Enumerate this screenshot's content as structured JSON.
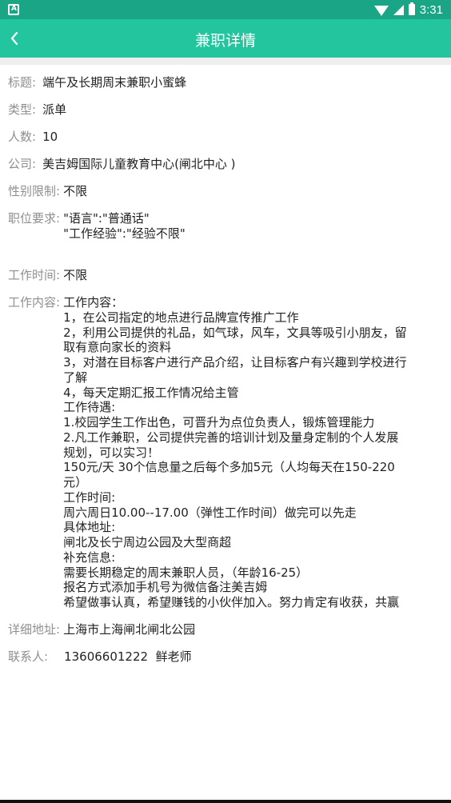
{
  "status_bar": {
    "time": "3:31",
    "notification_icon": "A"
  },
  "header": {
    "title": "兼职详情",
    "back_icon": "chevron-left-icon"
  },
  "colors": {
    "status_bar": "#1aa586",
    "app_bar": "#22c59e",
    "label": "#8f8f8f",
    "value": "#222222"
  },
  "details": {
    "title": {
      "label": "标题:",
      "value": "端午及长期周末兼职小蜜蜂"
    },
    "type": {
      "label": "类型:",
      "value": "派单"
    },
    "headcount": {
      "label": "人数:",
      "value": "10"
    },
    "company": {
      "label": "公司:",
      "value": "美吉姆国际儿童教育中心(闸北中心 )"
    },
    "gender": {
      "label": "性别限制:",
      "value": "不限"
    },
    "requirements": {
      "label": "职位要求:",
      "lines": [
        "\"语言\":\"普通话\"",
        "\"工作经验\":\"经验不限\""
      ]
    },
    "work_time": {
      "label": "工作时间:",
      "value": "不限"
    },
    "content": {
      "label": "工作内容:",
      "lines": [
        "工作内容：",
        "1，在公司指定的地点进行品牌宣传推广工作",
        "2，利用公司提供的礼品，如气球，风车，文具等吸引小朋友，留",
        "取有意向家长的资料",
        "3，对潜在目标客户进行产品介绍，让目标客户有兴趣到学校进行",
        "了解",
        "4，每天定期汇报工作情况给主管",
        "工作待遇:",
        "1.校园学生工作出色，可晋升为点位负责人，锻炼管理能力",
        "2.凡工作兼职，公司提供完善的培训计划及量身定制的个人发展",
        "规划，可以实习！",
        "150元/天 30个信息量之后每个多加5元（人均每天在150-220",
        "元）",
        "工作时间:",
        "周六周日10.00--17.00（弹性工作时间）做完可以先走",
        "具体地址:",
        "闸北及长宁周边公园及大型商超",
        "补充信息:",
        "需要长期稳定的周末兼职人员，（年龄16-25）",
        "报名方式添加手机号为微信备注美吉姆",
        "希望做事认真，希望赚钱的小伙伴加入。努力肯定有收获，共赢"
      ]
    },
    "address": {
      "label": "详细地址:",
      "value": "上海市上海闸北闸北公园"
    },
    "contact": {
      "label": "联系人:",
      "value": "13606601222  鲜老师"
    }
  }
}
